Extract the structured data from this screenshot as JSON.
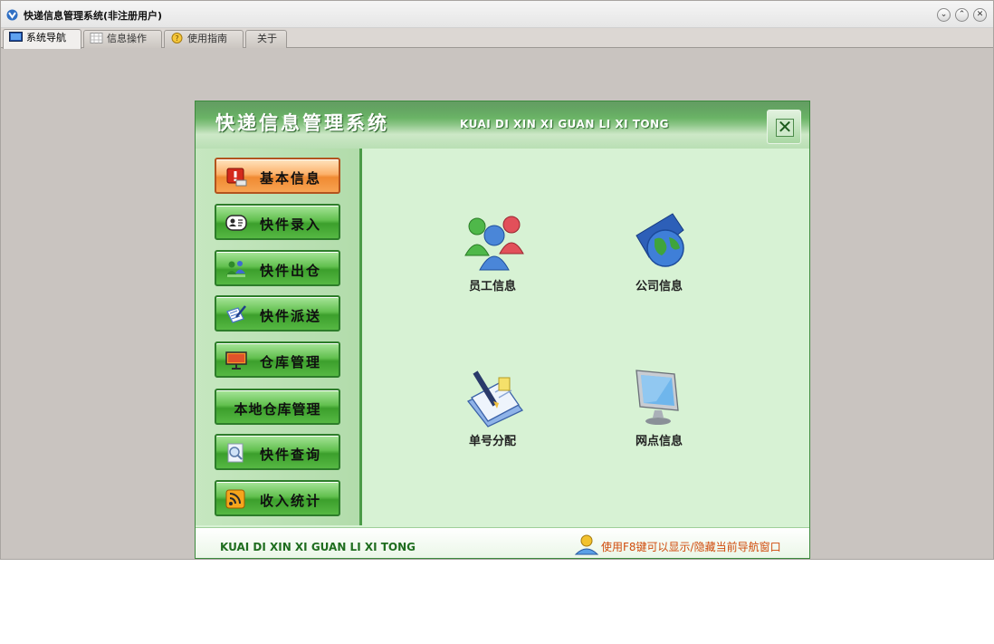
{
  "window": {
    "title": "快递信息管理系统(非注册用户)",
    "buttons": {
      "minimize": "⌄",
      "restore": "⌃",
      "close": "✕"
    }
  },
  "tabs": [
    {
      "label": "系统导航",
      "icon": "monitor-icon",
      "active": true
    },
    {
      "label": "信息操作",
      "icon": "grid-icon",
      "active": false
    },
    {
      "label": "使用指南",
      "icon": "help-icon",
      "active": false
    },
    {
      "label": "关于",
      "icon": "",
      "active": false
    }
  ],
  "banner": {
    "title": "快递信息管理系统",
    "pinyin": "KUAI DI XIN XI GUAN LI XI TONG",
    "close_glyph": "✕"
  },
  "sidebar": {
    "items": [
      {
        "label": "基本信息",
        "icon": "alert-icon",
        "active": true
      },
      {
        "label": "快件录入",
        "icon": "contact-card-icon",
        "active": false
      },
      {
        "label": "快件出仓",
        "icon": "people-icon",
        "active": false
      },
      {
        "label": "快件派送",
        "icon": "document-pen-icon",
        "active": false
      },
      {
        "label": "仓库管理",
        "icon": "presentation-icon",
        "active": false
      },
      {
        "label": "本地仓库管理",
        "icon": "",
        "active": false
      },
      {
        "label": "快件查询",
        "icon": "magnifier-icon",
        "active": false
      },
      {
        "label": "收入统计",
        "icon": "rss-icon",
        "active": false
      }
    ]
  },
  "content": {
    "items": [
      {
        "label": "员工信息",
        "icon": "users-icon"
      },
      {
        "label": "公司信息",
        "icon": "globe-icon"
      },
      {
        "label": "单号分配",
        "icon": "notebook-pen-icon"
      },
      {
        "label": "网点信息",
        "icon": "monitor-icon"
      }
    ]
  },
  "footer": {
    "left_text": "KUAI DI XIN XI GUAN LI XI TONG",
    "hint_text": "使用F8键可以显示/隐藏当前导航窗口"
  },
  "colors": {
    "accent_green": "#3c9f2c",
    "active_orange": "#f08a32",
    "hint_orange": "#d04b0c",
    "panel_bg": "#d7f2d4"
  }
}
